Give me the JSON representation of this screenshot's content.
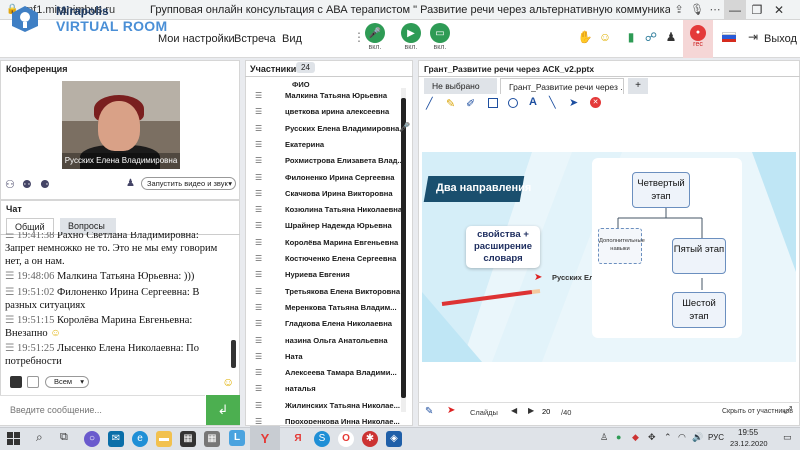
{
  "browser": {
    "url": "mf1.miranimbus.ru",
    "title": "Групповая онлайн консультация с АВА терапистом \" Развитие речи через альтернативную коммуникацию\"...."
  },
  "app": {
    "logo_line1": "Mirapolis",
    "logo_line2": "VIRTUAL ROOM",
    "menu": [
      "Мои настройки",
      "Встреча",
      "Вид"
    ],
    "mic_label": "вкл.",
    "cam_label": "вкл.",
    "screen_label": "вкл.",
    "rec_label": "rec",
    "exit_label": "Выход"
  },
  "conference": {
    "title": "Конференция",
    "video_caption": "Русских Елена Владимировна",
    "start_video_label": "Запустить видео и звук"
  },
  "chat": {
    "title": "Чат",
    "tabs": [
      "Общий",
      "Вопросы"
    ],
    "messages": [
      {
        "time": "19:41:38",
        "text": "Рахно Светлана  Владимировна: Запрет немножко не то. Это не мы ему говорим нет, а он нам."
      },
      {
        "time": "19:48:06",
        "text": "Малкина Татьяна  Юрьевна: )))"
      },
      {
        "time": "19:51:02",
        "text": "Филоненко Ирина  Сергеевна: В разных ситуациях"
      },
      {
        "time": "19:51:15",
        "text": "Королёва Марина Евгеньевна: Внезапно"
      },
      {
        "time": "19:51:25",
        "text": "Лысенко Елена  Николаевна: По потребности"
      }
    ],
    "audience_select": "Всем",
    "input_placeholder": "Введите сообщение..."
  },
  "participants": {
    "title": "Участники",
    "count": "24",
    "column_header": "ФИО",
    "list": [
      "Малкина Татьяна  Юрьевна",
      "цветкова  ирина алексеевна",
      "Русских Елена Владимировна",
      "Екатерина",
      "Рохмистрова  Елизавета Влад...",
      "Филоненко Ирина  Сергеевна",
      "Скачкова  Ирина Викторовна",
      "Козюлина  Татьяна Николаевна",
      "Шрайнер Надежда  Юрьевна",
      "Королёва Марина Евгеньевна",
      "Костюченко  Елена Сергеевна",
      "Нуриева Евгения",
      "Третьякова  Елена Викторовна",
      "Меренкова  Татьяна  Владим...",
      "Гладкова Елена Николаевна",
      "назина  Ольга  Анатольевна",
      "Ната",
      "Алексеева   Тамара  Владими...",
      "наталья",
      "Жилинских  Татьяна Николае...",
      "Прохоренкова  Инна Николае..."
    ]
  },
  "presentation": {
    "title": "Грант_Развитие речи через АСК_v2.pptx",
    "tabs": [
      "Не выбрано",
      "Грант_Развитие речи через ...",
      "+"
    ],
    "slide": {
      "banner": "Два направления",
      "left_box": "свойства + расширение словаря",
      "pointer_name": "Русских Елена Владимировна",
      "stage4": "Четвертый этап",
      "additional": "Дополнительные навыки",
      "stage5": "Пятый этап",
      "stage6": "Шестой этап"
    },
    "footer": {
      "slides_label": "Слайды",
      "current_page": "20",
      "total_pages": "/40",
      "hide_label": "Скрыть от участников"
    }
  },
  "taskbar": {
    "lang": "РУС",
    "time": "19:55",
    "date": "23.12.2020"
  },
  "colors": {
    "mic_green": "#2e9b55",
    "accent_blue": "#4a8fd6",
    "send_green": "#4caf50",
    "rec_red": "#e43a3a"
  }
}
